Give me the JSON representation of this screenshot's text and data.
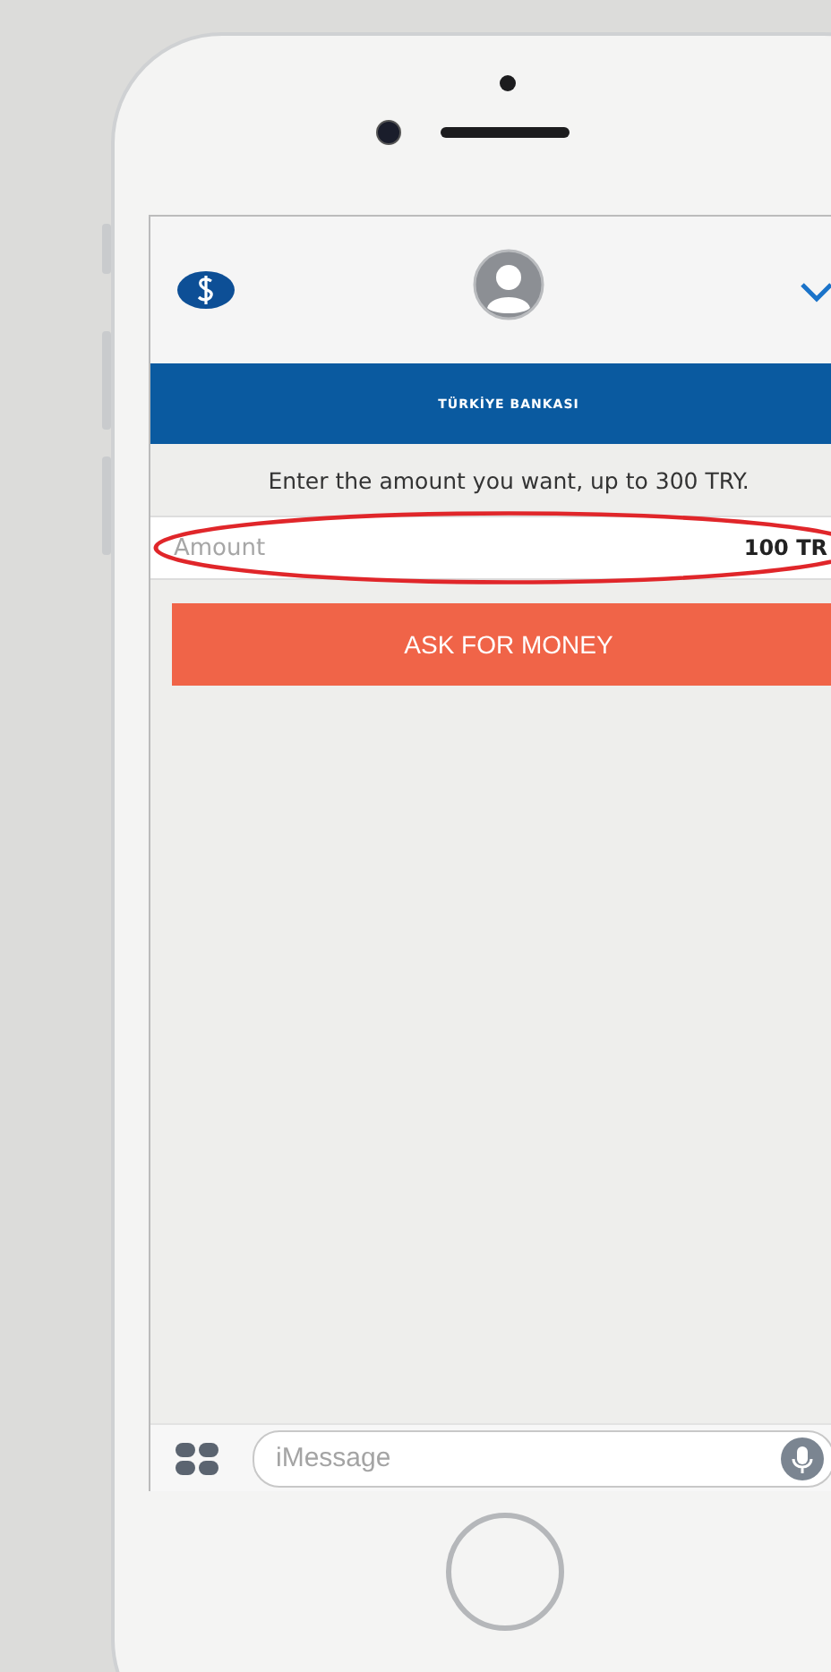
{
  "header": {
    "bank_logo": "TÜRKİYE BANKASI"
  },
  "instruction": "Enter the amount you want, up to 300 TRY.",
  "amount_field": {
    "label": "Amount",
    "value": "100 TR",
    "highlighted": true
  },
  "ask_button": "ASK FOR MONEY",
  "message_bar": {
    "placeholder": "iMessage"
  }
}
